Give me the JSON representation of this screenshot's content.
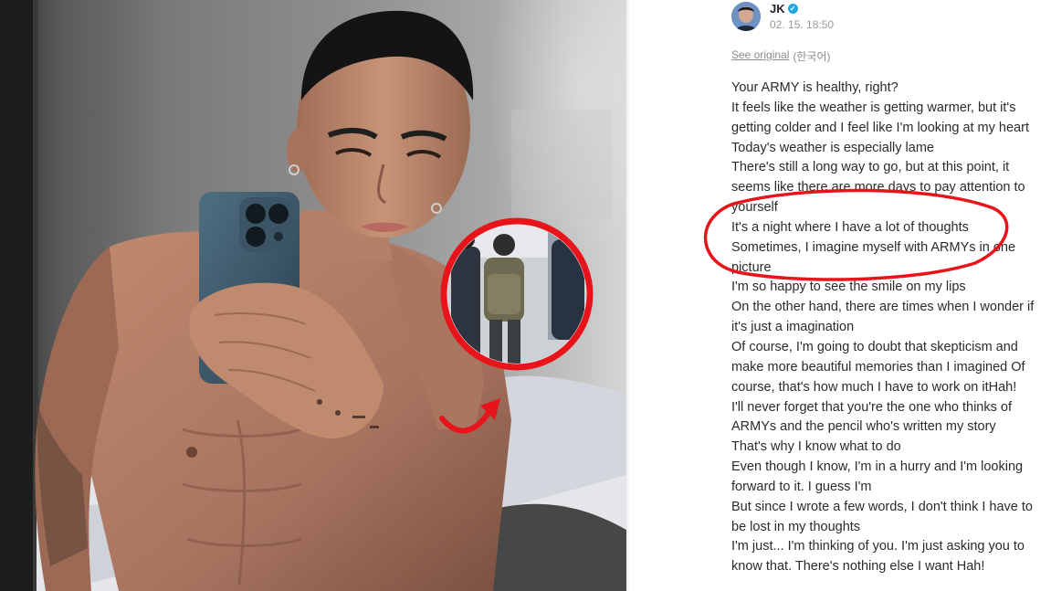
{
  "post": {
    "author": "JK",
    "timestamp": "02. 15. 18:50",
    "see_original_link": "See original",
    "see_original_lang": "(한국어)",
    "lines": [
      "Your ARMY is healthy, right?",
      "It feels like the weather is getting warmer, but it's",
      "getting colder and I feel like I'm looking at my heart",
      "Today's weather is especially lame",
      "There's still a long way to go, but at this point, it",
      "seems like there are more days to pay attention to",
      "yourself",
      "It's a night where I have a lot of thoughts",
      "Sometimes, I imagine myself with ARMYs in one",
      "picture",
      "I'm so happy to see the smile on my lips",
      "On the other hand, there are times when I wonder if",
      "it's just a imagination",
      "Of course, I'm going to doubt that skepticism and",
      "make more beautiful memories than I imagined Of",
      "course, that's how much I have to work on itHah!",
      "I'll never forget that you're the one who thinks of",
      "ARMYs and the pencil who's written my story",
      "That's why I know what to do",
      "Even though I know, I'm in a hurry and I'm looking",
      "forward to it. I guess I'm",
      "But since I wrote a few words, I don't think I have to",
      "be lost in my thoughts",
      "I'm just... I'm thinking of you. I'm just asking you to",
      "know that. There's nothing else I want Hah!"
    ]
  },
  "colors": {
    "annotation_red": "#e8141b",
    "verified_blue": "#20a7e0",
    "timestamp_gray": "#9a9a9a"
  },
  "icons": {
    "verified": "verified-badge-icon",
    "arrow": "curved-arrow-icon"
  }
}
